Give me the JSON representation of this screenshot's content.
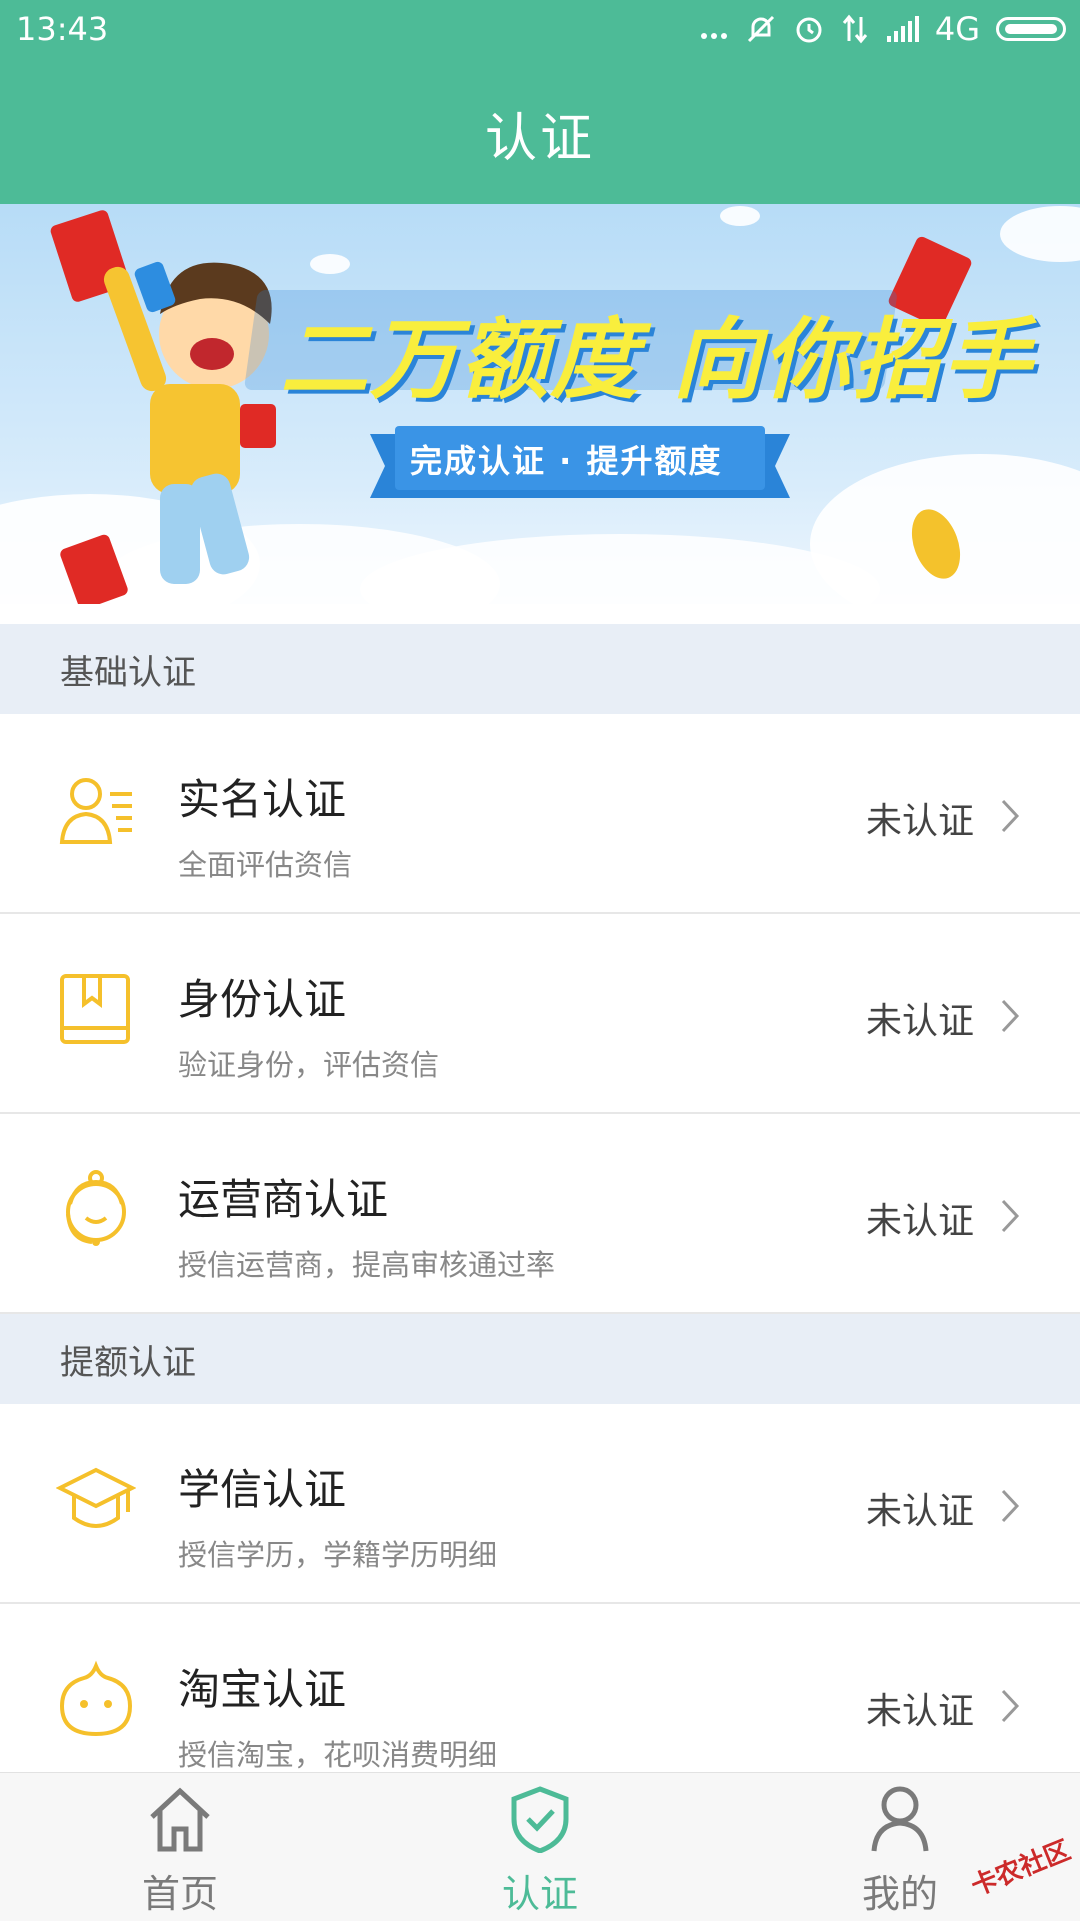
{
  "status_bar": {
    "time": "13:43",
    "network": "4G"
  },
  "header": {
    "title": "认证"
  },
  "banner": {
    "headline": "二万额度 向你招手",
    "subtitle": "完成认证 · 提升额度"
  },
  "sections": [
    {
      "title": "基础认证",
      "items": [
        {
          "title": "实名认证",
          "subtitle": "全面评估资信",
          "status": "未认证",
          "icon": "id-card-icon"
        },
        {
          "title": "身份认证",
          "subtitle": "验证身份，评估资信",
          "status": "未认证",
          "icon": "book-icon"
        },
        {
          "title": "运营商认证",
          "subtitle": "授信运营商，提高审核通过率",
          "status": "未认证",
          "icon": "headset-icon"
        }
      ]
    },
    {
      "title": "提额认证",
      "items": [
        {
          "title": "学信认证",
          "subtitle": "授信学历，学籍学历明细",
          "status": "未认证",
          "icon": "graduation-cap-icon"
        },
        {
          "title": "淘宝认证",
          "subtitle": "授信淘宝，花呗消费明细",
          "status": "未认证",
          "icon": "taobao-icon"
        }
      ]
    }
  ],
  "tabs": [
    {
      "label": "首页",
      "icon": "home-icon",
      "active": false
    },
    {
      "label": "认证",
      "icon": "shield-check-icon",
      "active": true
    },
    {
      "label": "我的",
      "icon": "person-icon",
      "active": false
    }
  ],
  "watermark": "卡农社区",
  "colors": {
    "brand": "#4dbb97",
    "icon_accent": "#f5c02b",
    "section_bg": "#e8eef6"
  }
}
